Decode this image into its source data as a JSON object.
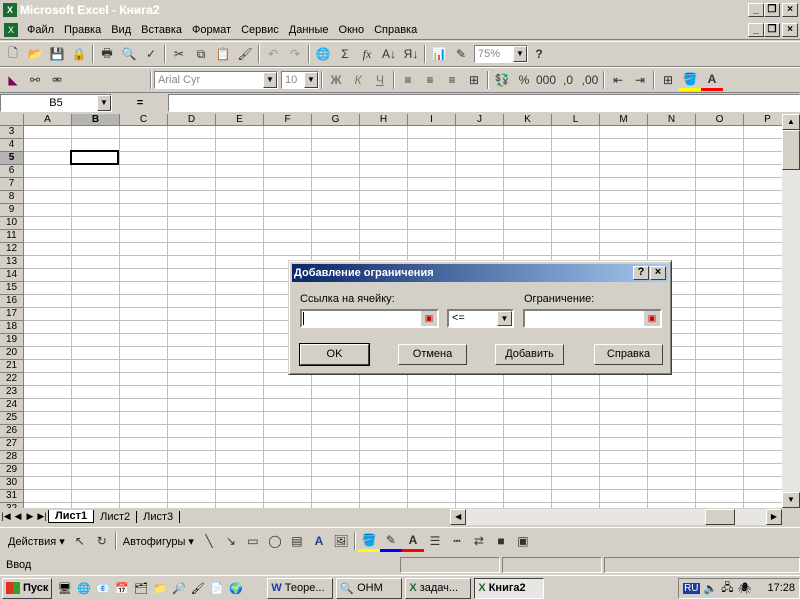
{
  "app": {
    "title": "Microsoft Excel - Книга2"
  },
  "menu": [
    "Файл",
    "Правка",
    "Вид",
    "Вставка",
    "Формат",
    "Сервис",
    "Данные",
    "Окно",
    "Справка"
  ],
  "toolbar": {
    "zoom": "75%",
    "font": "Arial Cyr",
    "font_size": "10",
    "bold": "Ж",
    "italic": "К",
    "underline": "Ч",
    "percent": "%",
    "sigma": "Σ",
    "fx": "fx"
  },
  "formula": {
    "name_box": "B5",
    "equals": "="
  },
  "grid": {
    "columns": [
      "A",
      "B",
      "C",
      "D",
      "E",
      "F",
      "G",
      "H",
      "I",
      "J",
      "K",
      "L",
      "M",
      "N",
      "O",
      "P"
    ],
    "rows": [
      "3",
      "4",
      "5",
      "6",
      "7",
      "8",
      "9",
      "10",
      "11",
      "12",
      "13",
      "14",
      "15",
      "16",
      "17",
      "18",
      "19",
      "20",
      "21",
      "22",
      "23",
      "24",
      "25",
      "26",
      "27",
      "28",
      "29",
      "30",
      "31",
      "32"
    ]
  },
  "sheets": [
    "Лист1",
    "Лист2",
    "Лист3"
  ],
  "drawbar": {
    "actions": "Действия",
    "autoshapes": "Автофигуры"
  },
  "status": {
    "mode": "Ввод"
  },
  "dialog": {
    "title": "Добавление ограничения",
    "help_btn": "?",
    "close_btn": "×",
    "cell_ref_label": "Ссылка на ячейку:",
    "constraint_label": "Ограничение:",
    "operator": "<=",
    "ok": "OK",
    "cancel": "Отмена",
    "add": "Добавить",
    "help": "Справка"
  },
  "taskbar": {
    "start": "Пуск",
    "tasks": [
      "Теоре...",
      "ОНМ",
      "задач...",
      "Книга2"
    ],
    "lang": "RU",
    "clock": "17:28"
  }
}
